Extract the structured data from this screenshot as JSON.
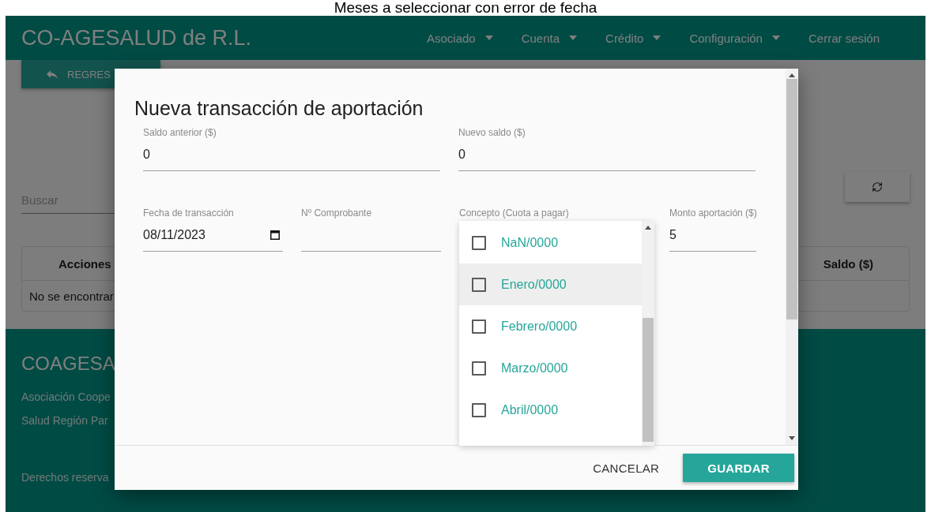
{
  "caption": "Meses a seleccionar con error de fecha",
  "header": {
    "brand": "CO-AGESALUD de R.L.",
    "nav": [
      {
        "label": "Asociado",
        "dropdown": true
      },
      {
        "label": "Cuenta",
        "dropdown": true
      },
      {
        "label": "Crédito",
        "dropdown": true
      },
      {
        "label": "Configuración",
        "dropdown": true
      },
      {
        "label": "Cerrar sesión",
        "dropdown": false
      }
    ]
  },
  "back_button": "REGRES",
  "search": {
    "placeholder": "Buscar"
  },
  "table": {
    "columns": [
      "Acciones",
      "Saldo ($)"
    ],
    "rows": [
      [
        "No se encontrar"
      ]
    ]
  },
  "footer": {
    "title": "COAGESA",
    "lines": [
      "Asociación Coope",
      "Salud Región Par"
    ],
    "copyright": "Derechos reserva"
  },
  "dialog": {
    "title": "Nueva transacción de aportación",
    "balance_fields": [
      {
        "kind": "text",
        "label": "Saldo anterior ($)",
        "value": "0"
      },
      {
        "kind": "text",
        "label": "Nuevo saldo ($)",
        "value": "0"
      }
    ],
    "transaction_fields": [
      {
        "kind": "date",
        "label": "Fecha de transacción",
        "value": "08/11/2023"
      },
      {
        "kind": "text",
        "label": "Nº Comprobante"
      },
      {
        "kind": "select",
        "label": "Concepto (Cuota a pagar)"
      },
      {
        "kind": "text",
        "label": "Monto aportación ($)",
        "value": "5"
      }
    ],
    "dropdown": {
      "items": [
        {
          "label": "NaN/0000",
          "checked": false,
          "highlighted": false
        },
        {
          "label": "Enero/0000",
          "checked": false,
          "highlighted": true
        },
        {
          "label": "Febrero/0000",
          "checked": false,
          "highlighted": false
        },
        {
          "label": "Marzo/0000",
          "checked": false,
          "highlighted": false
        },
        {
          "label": "Abril/0000",
          "checked": false,
          "highlighted": false
        }
      ]
    },
    "buttons": [
      {
        "label": "CANCELAR",
        "kind": "flat"
      },
      {
        "label": "GUARDAR",
        "kind": "raised"
      }
    ]
  }
}
